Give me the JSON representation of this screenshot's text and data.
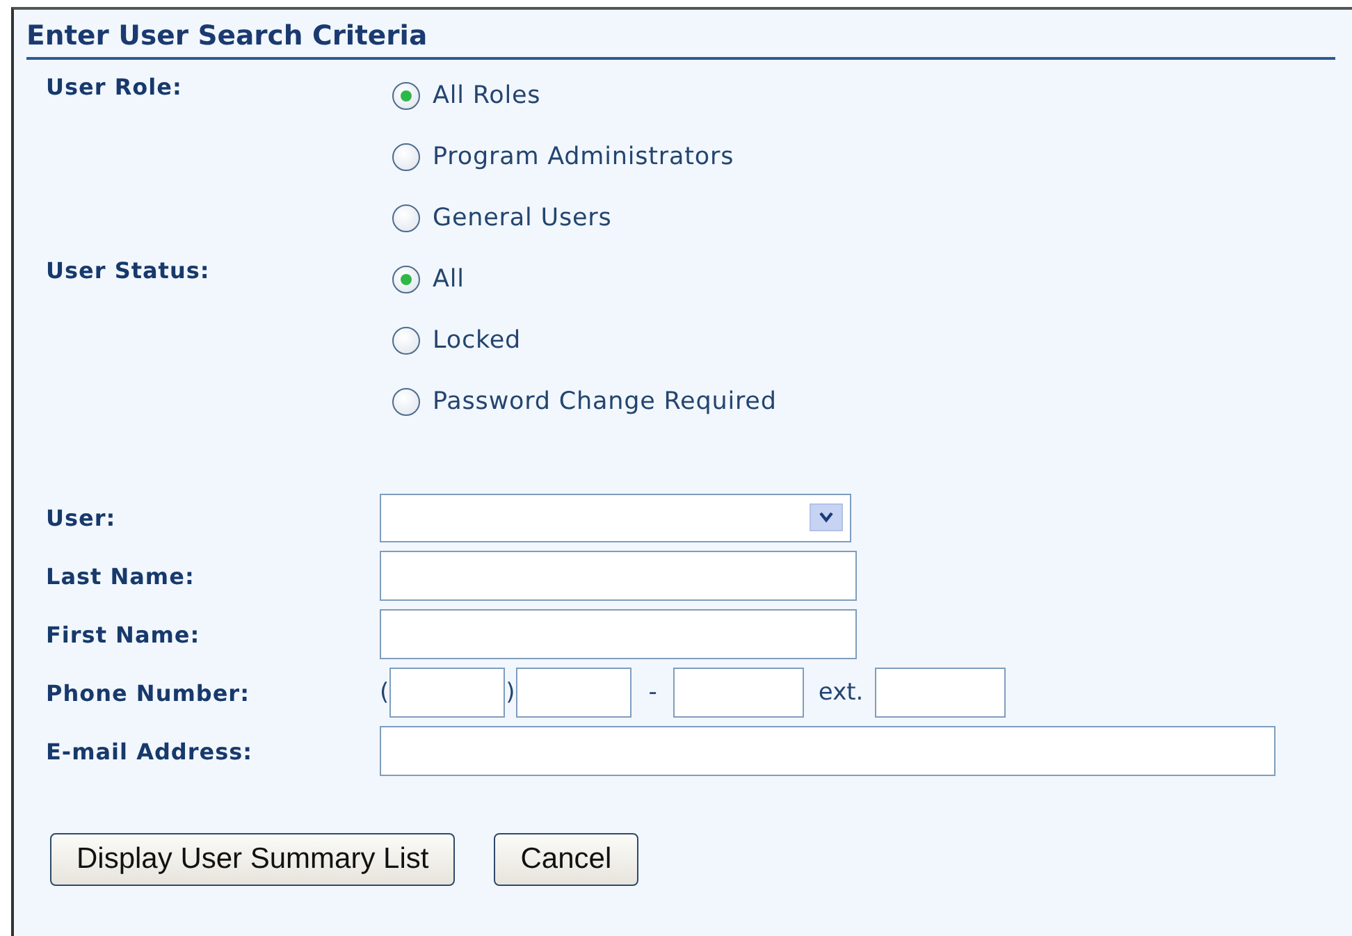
{
  "title": "Enter User Search Criteria",
  "radio_groups": [
    {
      "label": "User Role:",
      "options": [
        {
          "label": "All Roles",
          "selected": true
        },
        {
          "label": "Program Administrators",
          "selected": false
        },
        {
          "label": "General Users",
          "selected": false
        }
      ]
    },
    {
      "label": "User Status:",
      "options": [
        {
          "label": "All",
          "selected": true
        },
        {
          "label": "Locked",
          "selected": false
        },
        {
          "label": "Password Change Required",
          "selected": false
        }
      ]
    }
  ],
  "fields": [
    {
      "label": "User:",
      "kind": "dropdown"
    },
    {
      "label": "Last Name:",
      "kind": "text"
    },
    {
      "label": "First Name:",
      "kind": "text"
    },
    {
      "label": "Phone Number:",
      "kind": "phone",
      "separators": [
        "(",
        ")",
        "-",
        "ext."
      ]
    },
    {
      "label": "E-mail Address:",
      "kind": "wide"
    }
  ],
  "buttons": [
    "Display User Summary List",
    "Cancel"
  ]
}
